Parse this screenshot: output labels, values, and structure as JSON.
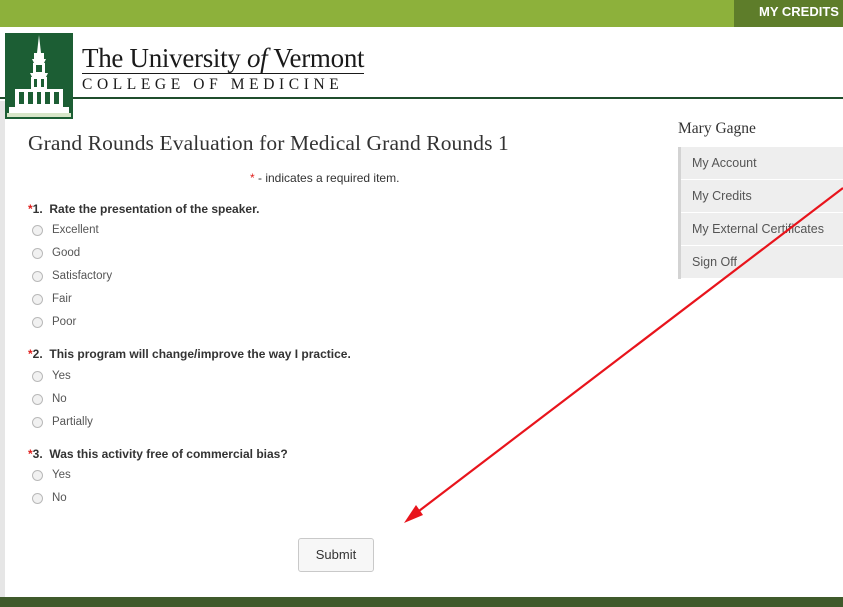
{
  "topbar": {
    "link": "MY CREDITS"
  },
  "logo": {
    "line1_pre": "The University ",
    "line1_of": "of",
    "line1_post": " Vermont",
    "line2": "COLLEGE OF MEDICINE"
  },
  "evaluation": {
    "title": "Grand Rounds Evaluation for Medical Grand Rounds 1",
    "required_star": "*",
    "required_note": " - indicates a required item.",
    "questions": [
      {
        "number": "1.",
        "text": "Rate the presentation of the speaker.",
        "options": [
          "Excellent",
          "Good",
          "Satisfactory",
          "Fair",
          "Poor"
        ]
      },
      {
        "number": "2.",
        "text": "This program will change/improve the way I practice.",
        "options": [
          "Yes",
          "No",
          "Partially"
        ]
      },
      {
        "number": "3.",
        "text": "Was this activity free of commercial bias?",
        "options": [
          "Yes",
          "No"
        ]
      }
    ],
    "submit_label": "Submit"
  },
  "sidebar": {
    "user_name": "Mary Gagne",
    "items": [
      {
        "label": "My Account"
      },
      {
        "label": "My Credits"
      },
      {
        "label": "My External Certificates"
      },
      {
        "label": "Sign Off"
      }
    ]
  },
  "colors": {
    "topbar": "#8db13b",
    "topbar_link_bg": "#5e7d2a",
    "logo_green": "#1c5e34",
    "footer": "#3f5a2b",
    "required_star": "#e0201d",
    "annotation_arrow": "#e8141c"
  }
}
